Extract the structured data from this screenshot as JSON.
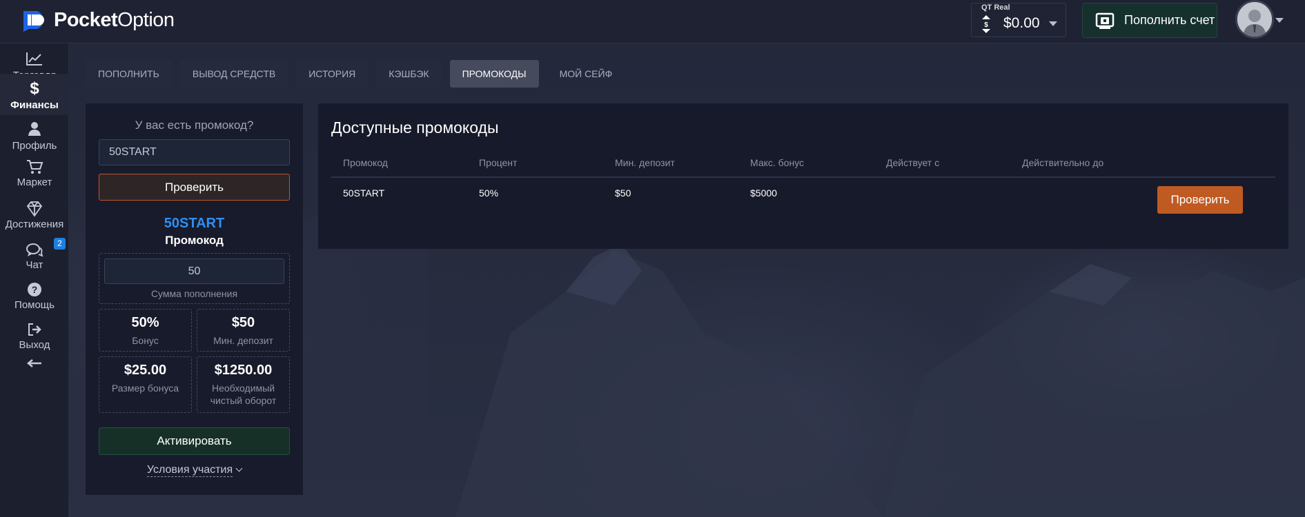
{
  "header": {
    "logo_bold": "Pocket",
    "logo_light": "Option",
    "account_type": "QT Real",
    "balance": "$0.00",
    "deposit_button": "Пополнить счет"
  },
  "sidebar": {
    "items": [
      {
        "label": "Торговля",
        "icon": "chart-line-icon"
      },
      {
        "label": "Финансы",
        "icon": "dollar-icon",
        "active": true
      },
      {
        "label": "Профиль",
        "icon": "user-icon"
      },
      {
        "label": "Маркет",
        "icon": "cart-icon"
      },
      {
        "label": "Достижения",
        "icon": "diamond-icon"
      },
      {
        "label": "Чат",
        "icon": "chat-icon",
        "badge": "2"
      },
      {
        "label": "Помощь",
        "icon": "help-icon"
      },
      {
        "label": "Выход",
        "icon": "logout-icon"
      }
    ],
    "collapse_icon": "arrow-left-icon"
  },
  "tabs": [
    {
      "label": "ПОПОЛНИТЬ"
    },
    {
      "label": "ВЫВОД СРЕДСТВ"
    },
    {
      "label": "ИСТОРИЯ"
    },
    {
      "label": "КЭШБЭК"
    },
    {
      "label": "ПРОМОКОДЫ",
      "active": true
    },
    {
      "label": "МОЙ СЕЙФ"
    }
  ],
  "promo_form": {
    "question": "У вас есть промокод?",
    "code_value": "50START",
    "check_button": "Проверить",
    "code_display": "50START",
    "code_caption": "Промокод",
    "deposit_amount": "50",
    "deposit_amount_label": "Сумма пополнения",
    "bonus_value": "50%",
    "bonus_label": "Бонус",
    "min_deposit_value": "$50",
    "min_deposit_label": "Мин. депозит",
    "bonus_size_value": "$25.00",
    "bonus_size_label": "Размер бонуса",
    "turnover_value": "$1250.00",
    "turnover_label": "Необходимый чистый оборот",
    "activate_button": "Активировать",
    "terms_link": "Условия участия"
  },
  "available": {
    "title": "Доступные промокоды",
    "columns": [
      "Промокод",
      "Процент",
      "Мин. депозит",
      "Макс. бонус",
      "Действует с",
      "Действительно до"
    ],
    "rows": [
      {
        "code": "50START",
        "percent": "50%",
        "min_deposit": "$50",
        "max_bonus": "$5000",
        "valid_from": "",
        "valid_to": "",
        "action": "Проверить"
      }
    ]
  },
  "colors": {
    "accent_blue": "#2f8ff1",
    "accent_orange": "#c05a23",
    "accent_green": "#163028"
  }
}
